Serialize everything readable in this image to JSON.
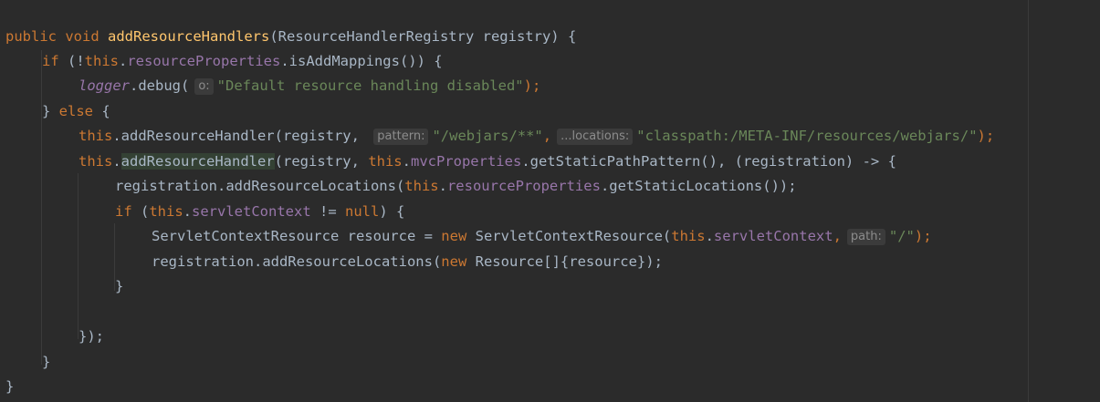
{
  "code": {
    "l1": {
      "kw_public": "public",
      "kw_void": "void",
      "method": "addResourceHandlers",
      "params": "(ResourceHandlerRegistry registry) {"
    },
    "l2": {
      "kw_if": "if",
      "t1": " (!",
      "kw_this": "this",
      "dot": ".",
      "field": "resourceProperties",
      "t2": ".isAddMappings()) {"
    },
    "l3": {
      "logger": "logger",
      "t1": ".debug(",
      "hint": "o:",
      "str": "\"Default resource handling disabled\"",
      "t2": ");"
    },
    "l4": {
      "t1": "} ",
      "kw_else": "else",
      "t2": " {"
    },
    "l5": {
      "kw_this": "this",
      "t1": ".addResourceHandler(registry, ",
      "hint1": "pattern:",
      "str1": "\"/webjars/**\"",
      "comma": ",",
      "hint2": "...locations:",
      "str2": "\"classpath:/META-INF/resources/webjars/\"",
      "t2": ");"
    },
    "l6": {
      "kw_this": "this",
      "dot": ".",
      "method": "addResourceHandler",
      "t1": "(registry, ",
      "kw_this2": "this",
      "dot2": ".",
      "field": "mvcProperties",
      "t2": ".getStaticPathPattern(), (registration) -> {"
    },
    "l7": {
      "t1": "registration.addResourceLocations(",
      "kw_this": "this",
      "dot": ".",
      "field": "resourceProperties",
      "t2": ".getStaticLocations());"
    },
    "l8": {
      "kw_if": "if",
      "t1": " (",
      "kw_this": "this",
      "dot": ".",
      "field": "servletContext",
      "t2": " != ",
      "kw_null": "null",
      "t3": ") {"
    },
    "l9": {
      "t1": "ServletContextResource resource = ",
      "kw_new": "new",
      "t2": " ServletContextResource(",
      "kw_this": "this",
      "dot": ".",
      "field": "servletContext",
      "comma": ",",
      "hint": "path:",
      "str": "\"/\"",
      "t3": ");"
    },
    "l10": {
      "t1": "registration.addResourceLocations(",
      "kw_new": "new",
      "t2": " Resource[]{resource});"
    },
    "l11": {
      "t1": "}"
    },
    "l13": {
      "t1": "});"
    },
    "l14": {
      "t1": "}"
    },
    "l15": {
      "t1": "}"
    }
  },
  "colors": {
    "background": "#2b2b2b",
    "keyword": "#cc7832",
    "method_decl": "#ffc66d",
    "field": "#9876aa",
    "string": "#6a8759",
    "plain": "#a9b7c6",
    "inlay_hint": "#8c8c8c"
  }
}
